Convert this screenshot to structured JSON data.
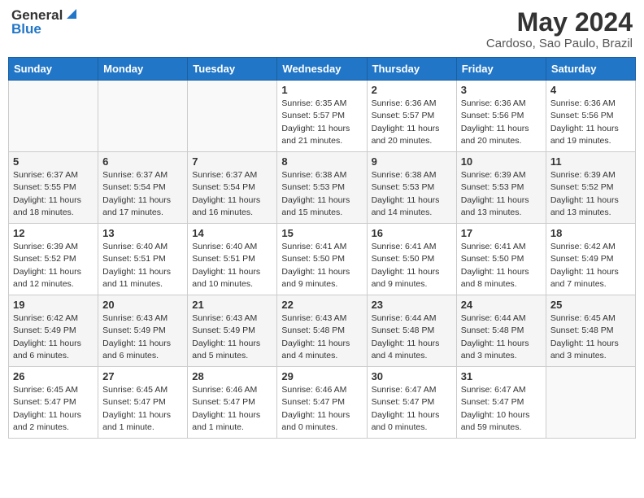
{
  "header": {
    "logo_line1": "General",
    "logo_line2": "Blue",
    "month_year": "May 2024",
    "location": "Cardoso, Sao Paulo, Brazil"
  },
  "weekdays": [
    "Sunday",
    "Monday",
    "Tuesday",
    "Wednesday",
    "Thursday",
    "Friday",
    "Saturday"
  ],
  "weeks": [
    [
      {
        "day": "",
        "info": ""
      },
      {
        "day": "",
        "info": ""
      },
      {
        "day": "",
        "info": ""
      },
      {
        "day": "1",
        "info": "Sunrise: 6:35 AM\nSunset: 5:57 PM\nDaylight: 11 hours\nand 21 minutes."
      },
      {
        "day": "2",
        "info": "Sunrise: 6:36 AM\nSunset: 5:57 PM\nDaylight: 11 hours\nand 20 minutes."
      },
      {
        "day": "3",
        "info": "Sunrise: 6:36 AM\nSunset: 5:56 PM\nDaylight: 11 hours\nand 20 minutes."
      },
      {
        "day": "4",
        "info": "Sunrise: 6:36 AM\nSunset: 5:56 PM\nDaylight: 11 hours\nand 19 minutes."
      }
    ],
    [
      {
        "day": "5",
        "info": "Sunrise: 6:37 AM\nSunset: 5:55 PM\nDaylight: 11 hours\nand 18 minutes."
      },
      {
        "day": "6",
        "info": "Sunrise: 6:37 AM\nSunset: 5:54 PM\nDaylight: 11 hours\nand 17 minutes."
      },
      {
        "day": "7",
        "info": "Sunrise: 6:37 AM\nSunset: 5:54 PM\nDaylight: 11 hours\nand 16 minutes."
      },
      {
        "day": "8",
        "info": "Sunrise: 6:38 AM\nSunset: 5:53 PM\nDaylight: 11 hours\nand 15 minutes."
      },
      {
        "day": "9",
        "info": "Sunrise: 6:38 AM\nSunset: 5:53 PM\nDaylight: 11 hours\nand 14 minutes."
      },
      {
        "day": "10",
        "info": "Sunrise: 6:39 AM\nSunset: 5:53 PM\nDaylight: 11 hours\nand 13 minutes."
      },
      {
        "day": "11",
        "info": "Sunrise: 6:39 AM\nSunset: 5:52 PM\nDaylight: 11 hours\nand 13 minutes."
      }
    ],
    [
      {
        "day": "12",
        "info": "Sunrise: 6:39 AM\nSunset: 5:52 PM\nDaylight: 11 hours\nand 12 minutes."
      },
      {
        "day": "13",
        "info": "Sunrise: 6:40 AM\nSunset: 5:51 PM\nDaylight: 11 hours\nand 11 minutes."
      },
      {
        "day": "14",
        "info": "Sunrise: 6:40 AM\nSunset: 5:51 PM\nDaylight: 11 hours\nand 10 minutes."
      },
      {
        "day": "15",
        "info": "Sunrise: 6:41 AM\nSunset: 5:50 PM\nDaylight: 11 hours\nand 9 minutes."
      },
      {
        "day": "16",
        "info": "Sunrise: 6:41 AM\nSunset: 5:50 PM\nDaylight: 11 hours\nand 9 minutes."
      },
      {
        "day": "17",
        "info": "Sunrise: 6:41 AM\nSunset: 5:50 PM\nDaylight: 11 hours\nand 8 minutes."
      },
      {
        "day": "18",
        "info": "Sunrise: 6:42 AM\nSunset: 5:49 PM\nDaylight: 11 hours\nand 7 minutes."
      }
    ],
    [
      {
        "day": "19",
        "info": "Sunrise: 6:42 AM\nSunset: 5:49 PM\nDaylight: 11 hours\nand 6 minutes."
      },
      {
        "day": "20",
        "info": "Sunrise: 6:43 AM\nSunset: 5:49 PM\nDaylight: 11 hours\nand 6 minutes."
      },
      {
        "day": "21",
        "info": "Sunrise: 6:43 AM\nSunset: 5:49 PM\nDaylight: 11 hours\nand 5 minutes."
      },
      {
        "day": "22",
        "info": "Sunrise: 6:43 AM\nSunset: 5:48 PM\nDaylight: 11 hours\nand 4 minutes."
      },
      {
        "day": "23",
        "info": "Sunrise: 6:44 AM\nSunset: 5:48 PM\nDaylight: 11 hours\nand 4 minutes."
      },
      {
        "day": "24",
        "info": "Sunrise: 6:44 AM\nSunset: 5:48 PM\nDaylight: 11 hours\nand 3 minutes."
      },
      {
        "day": "25",
        "info": "Sunrise: 6:45 AM\nSunset: 5:48 PM\nDaylight: 11 hours\nand 3 minutes."
      }
    ],
    [
      {
        "day": "26",
        "info": "Sunrise: 6:45 AM\nSunset: 5:47 PM\nDaylight: 11 hours\nand 2 minutes."
      },
      {
        "day": "27",
        "info": "Sunrise: 6:45 AM\nSunset: 5:47 PM\nDaylight: 11 hours\nand 1 minute."
      },
      {
        "day": "28",
        "info": "Sunrise: 6:46 AM\nSunset: 5:47 PM\nDaylight: 11 hours\nand 1 minute."
      },
      {
        "day": "29",
        "info": "Sunrise: 6:46 AM\nSunset: 5:47 PM\nDaylight: 11 hours\nand 0 minutes."
      },
      {
        "day": "30",
        "info": "Sunrise: 6:47 AM\nSunset: 5:47 PM\nDaylight: 11 hours\nand 0 minutes."
      },
      {
        "day": "31",
        "info": "Sunrise: 6:47 AM\nSunset: 5:47 PM\nDaylight: 10 hours\nand 59 minutes."
      },
      {
        "day": "",
        "info": ""
      }
    ]
  ]
}
